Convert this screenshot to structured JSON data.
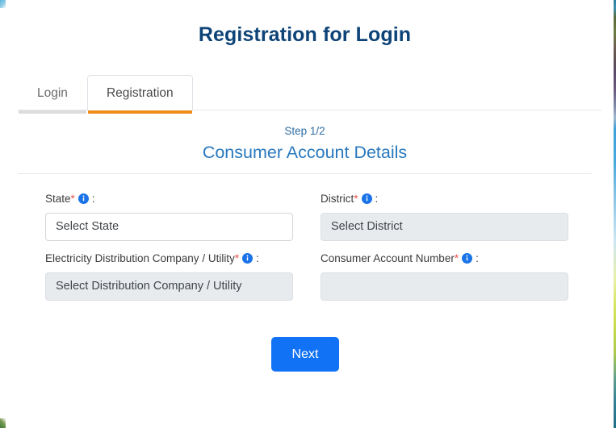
{
  "page": {
    "title": "Registration for Login"
  },
  "tabs": [
    {
      "label": "Login",
      "active": false
    },
    {
      "label": "Registration",
      "active": true
    }
  ],
  "step": {
    "label": "Step 1/2",
    "section_title": "Consumer Account Details"
  },
  "form": {
    "fields": [
      {
        "label": "State",
        "required_marker": "*",
        "colon": ":",
        "info_icon": "info-circle-icon",
        "value": "Select State",
        "disabled": false
      },
      {
        "label": "District",
        "required_marker": "*",
        "colon": ":",
        "info_icon": "info-circle-icon",
        "value": "Select District",
        "disabled": true
      },
      {
        "label": "Electricity Distribution Company / Utility",
        "required_marker": "*",
        "colon": ":",
        "info_icon": "info-circle-icon",
        "value": "Select Distribution Company / Utility",
        "disabled": true
      },
      {
        "label": "Consumer Account Number",
        "required_marker": "*",
        "colon": ":",
        "info_icon": "info-circle-icon",
        "value": "",
        "disabled": true
      }
    ],
    "next_button": "Next"
  },
  "colors": {
    "page_title": "#0d4377",
    "section_title": "#2878bd",
    "step_label": "#2e6da4",
    "active_tab_underline": "#ef8b1b",
    "inactive_tab_underline": "#dcdcdc",
    "primary_button": "#1272f5",
    "required_star": "#e8544a",
    "info_icon": "#1a73e8",
    "disabled_field_bg": "#e8ebee"
  }
}
